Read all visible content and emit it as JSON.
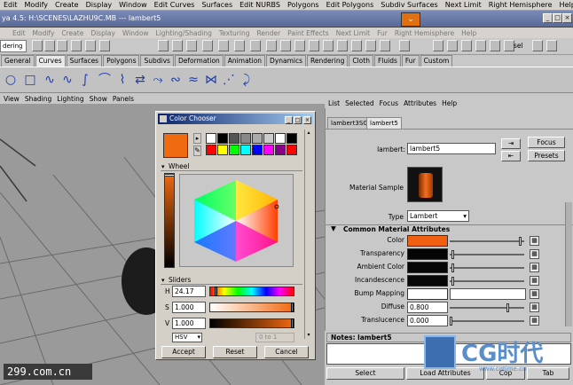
{
  "app_menu": [
    "Edit",
    "Modify",
    "Create",
    "Display",
    "Window",
    "Edit Curves",
    "Surfaces",
    "Edit NURBS",
    "Polygons",
    "Edit Polygons",
    "Subdiv Surfaces",
    "Next Limit",
    "Right Hemisphere",
    "Help"
  ],
  "window_title": "ya 4.5: H:\\SCENES\\LAZHU9C.MB  ---  lambert5",
  "app_menu2": [
    "Edit",
    "Modify",
    "Create",
    "Display",
    "Window",
    "Lighting/Shading",
    "Texturing",
    "Render",
    "Paint Effects",
    "Next Limit",
    "Fur",
    "Right Hemisphere",
    "Help"
  ],
  "mode_select": "dering",
  "sel_label": "sel",
  "shelf_tabs": [
    "General",
    "Curves",
    "Surfaces",
    "Polygons",
    "Subdivs",
    "Deformation",
    "Animation",
    "Dynamics",
    "Rendering",
    "Cloth",
    "Fluids",
    "Fur",
    "Custom"
  ],
  "shelf_active": "Curves",
  "panel_menu": [
    "View",
    "Shading",
    "Lighting",
    "Show",
    "Panels"
  ],
  "attr_editor": {
    "menu": [
      "List",
      "Selected",
      "Focus",
      "Attributes",
      "Help"
    ],
    "tabs": [
      "lambert3SG",
      "lambert5"
    ],
    "node_label": "lambert:",
    "node_name": "lambert5",
    "focus_btn": "Focus",
    "presets_btn": "Presets",
    "material_sample": "Material Sample",
    "type_label": "Type",
    "type_value": "Lambert",
    "section": "Common Material Attributes",
    "rows": [
      {
        "label": "Color",
        "color": "#f06010",
        "slider": 0.98
      },
      {
        "label": "Transparency",
        "color": "#050505",
        "slider": 0.02
      },
      {
        "label": "Ambient Color",
        "color": "#050505",
        "slider": 0.02
      },
      {
        "label": "Incandescence",
        "color": "#050505",
        "slider": 0.02
      },
      {
        "label": "Bump Mapping",
        "color": "#ffffff",
        "slider": null
      },
      {
        "label": "Diffuse",
        "value": "0.800",
        "slider": 0.8
      },
      {
        "label": "Translucence",
        "value": "0.000",
        "slider": 0.0
      }
    ],
    "notes_label": "Notes: lambert5",
    "select_btn": "Select",
    "load_btn": "Load Attributes",
    "copy_btn": "Cop",
    "tab_btn": "Tab"
  },
  "color_chooser": {
    "title": "Color Chooser",
    "current_color": "#f06a10",
    "palette": [
      "#ffffff",
      "#000000",
      "#555555",
      "#888888",
      "#aaaaaa",
      "#cccccc",
      "#ffffff",
      "#000000",
      "#ff0000",
      "#ffff00",
      "#00ff00",
      "#00ffff",
      "#0000ff",
      "#ff00ff",
      "#880088",
      "#ff0000"
    ],
    "wheel_label": "Wheel",
    "sliders_label": "Sliders",
    "h_label": "H",
    "h_value": "24.17",
    "s_label": "S",
    "s_value": "1.000",
    "v_label": "V",
    "v_value": "1.000",
    "mode": "HSV",
    "range": "0 to 1",
    "accept": "Accept",
    "reset": "Reset",
    "cancel": "Cancel"
  },
  "watermark_left": "299.com.cn",
  "watermark_right": "CG时代",
  "watermark_url": "www.cgtime.cn"
}
